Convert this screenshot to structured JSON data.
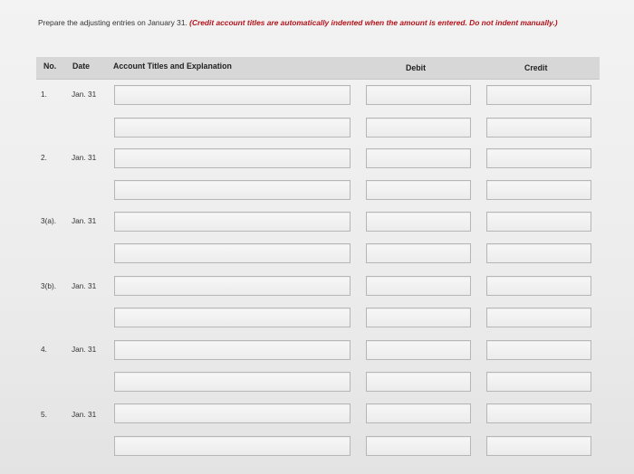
{
  "instruction": {
    "text": "Prepare the adjusting entries on January 31.",
    "note": "(Credit account titles are automatically indented when the amount is entered. Do not indent manually.)"
  },
  "table": {
    "headers": {
      "no": "No.",
      "date": "Date",
      "account": "Account Titles and Explanation",
      "debit": "Debit",
      "credit": "Credit"
    },
    "entries": [
      {
        "no": "1.",
        "date": "Jan. 31"
      },
      {
        "no": "2.",
        "date": "Jan. 31"
      },
      {
        "no": "3(a).",
        "date": "Jan. 31"
      },
      {
        "no": "3(b).",
        "date": "Jan. 31"
      },
      {
        "no": "4.",
        "date": "Jan. 31"
      },
      {
        "no": "5.",
        "date": "Jan. 31"
      }
    ]
  }
}
